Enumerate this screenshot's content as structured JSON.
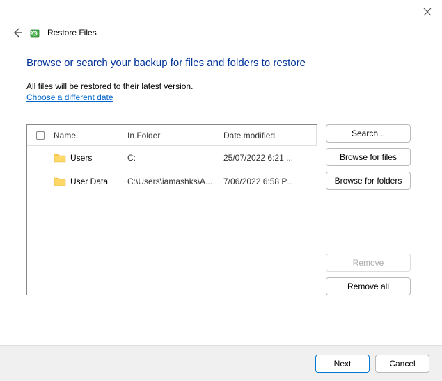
{
  "window": {
    "title": "Restore Files"
  },
  "content": {
    "heading": "Browse or search your backup for files and folders to restore",
    "subtext": "All files will be restored to their latest version.",
    "link": "Choose a different date"
  },
  "table": {
    "columns": {
      "name": "Name",
      "folder": "In Folder",
      "date": "Date modified"
    },
    "rows": [
      {
        "name": "Users",
        "folder": "C:",
        "date": "25/07/2022 6:21 ..."
      },
      {
        "name": "User Data",
        "folder": "C:\\Users\\iamashks\\A...",
        "date": "7/06/2022 6:58 P..."
      }
    ]
  },
  "buttons": {
    "search": "Search...",
    "browse_files": "Browse for files",
    "browse_folders": "Browse for folders",
    "remove": "Remove",
    "remove_all": "Remove all",
    "next": "Next",
    "cancel": "Cancel"
  }
}
